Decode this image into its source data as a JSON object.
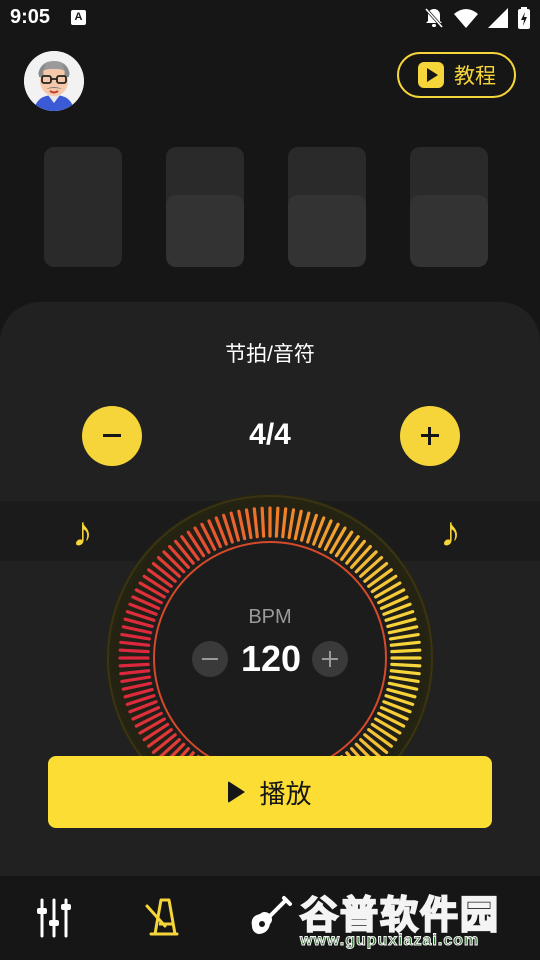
{
  "status_bar": {
    "time": "9:05",
    "icons": [
      "keyboard-a-icon",
      "notifications-off-icon",
      "wifi-icon",
      "signal-icon",
      "battery-charging-icon"
    ]
  },
  "header": {
    "tutorial_label": "教程"
  },
  "beats": {
    "count": 4
  },
  "panel": {
    "title": "节拍/音符",
    "meter_value": "4/4"
  },
  "dial": {
    "bpm_label": "BPM",
    "bpm_value": "120"
  },
  "play_button": {
    "label": "播放"
  },
  "bottom_nav": {
    "items": [
      {
        "icon": "mixer-icon",
        "active": false
      },
      {
        "icon": "metronome-icon",
        "active": true
      },
      {
        "icon": "guitar-icon",
        "active": false
      }
    ]
  },
  "watermark": {
    "text": "谷普软件园",
    "url": "www.gupuxiazai.com"
  },
  "colors": {
    "accent": "#f6d53a",
    "background": "#161616",
    "panel": "#212121"
  }
}
